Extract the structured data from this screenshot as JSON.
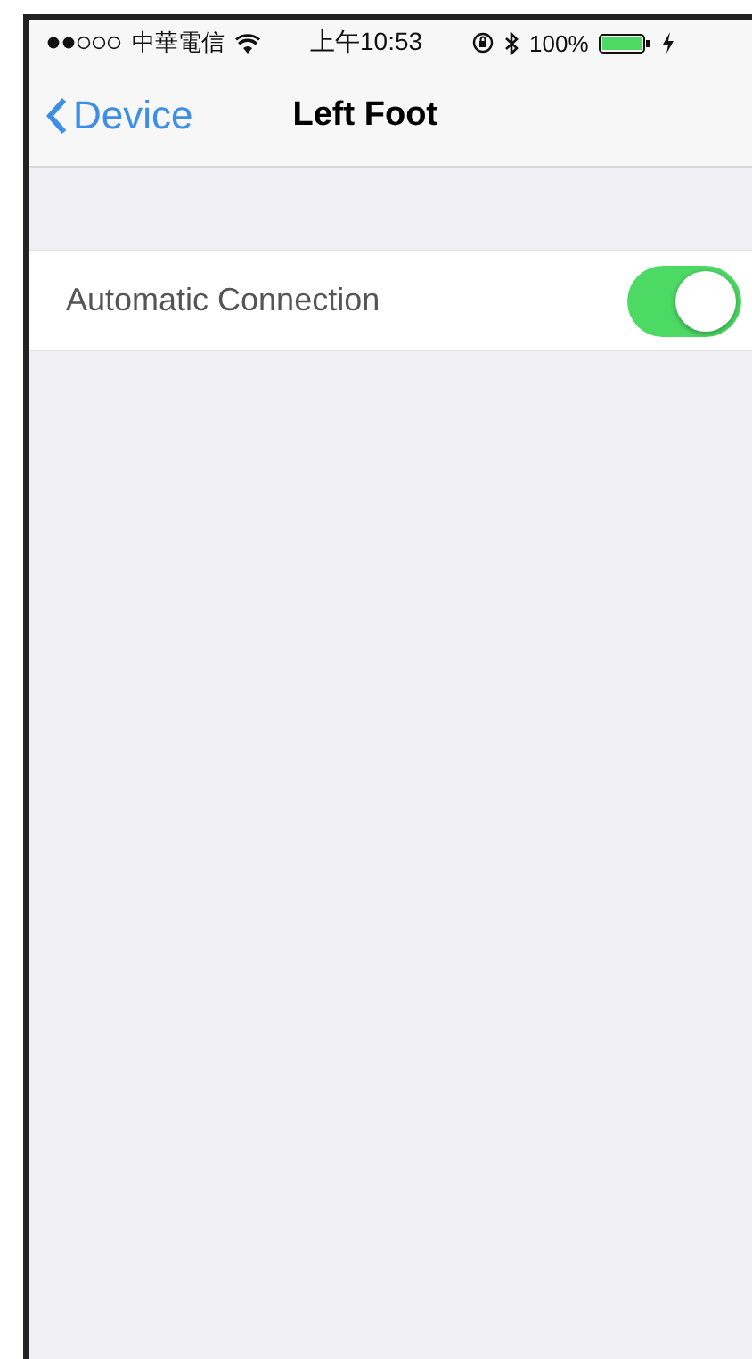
{
  "status_bar": {
    "carrier": "中華電信",
    "time": "上午10:53",
    "battery": "100%"
  },
  "nav_bar": {
    "back": "Device",
    "title": "Left Foot"
  },
  "settings": [
    {
      "kind": "toggle",
      "label": "Automatic Connection",
      "on": true
    }
  ]
}
